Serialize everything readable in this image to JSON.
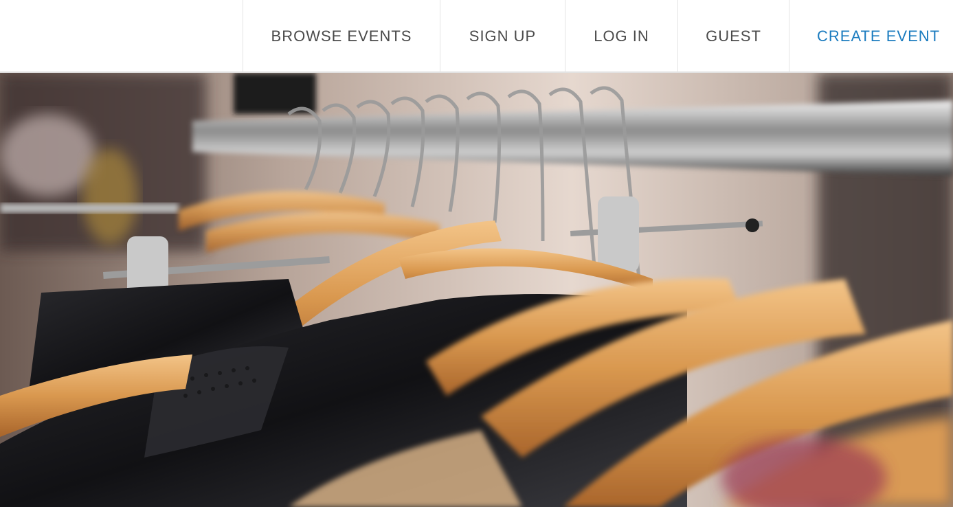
{
  "nav": {
    "items": [
      {
        "label": "BROWSE EVENTS"
      },
      {
        "label": "SIGN UP"
      },
      {
        "label": "LOG IN"
      },
      {
        "label": "GUEST"
      },
      {
        "label": "CREATE EVENT"
      }
    ],
    "accent_color": "#1a7bbf",
    "text_color": "#4a4a4a"
  },
  "hero": {
    "image": "clothing-rack-with-wooden-hangers"
  }
}
